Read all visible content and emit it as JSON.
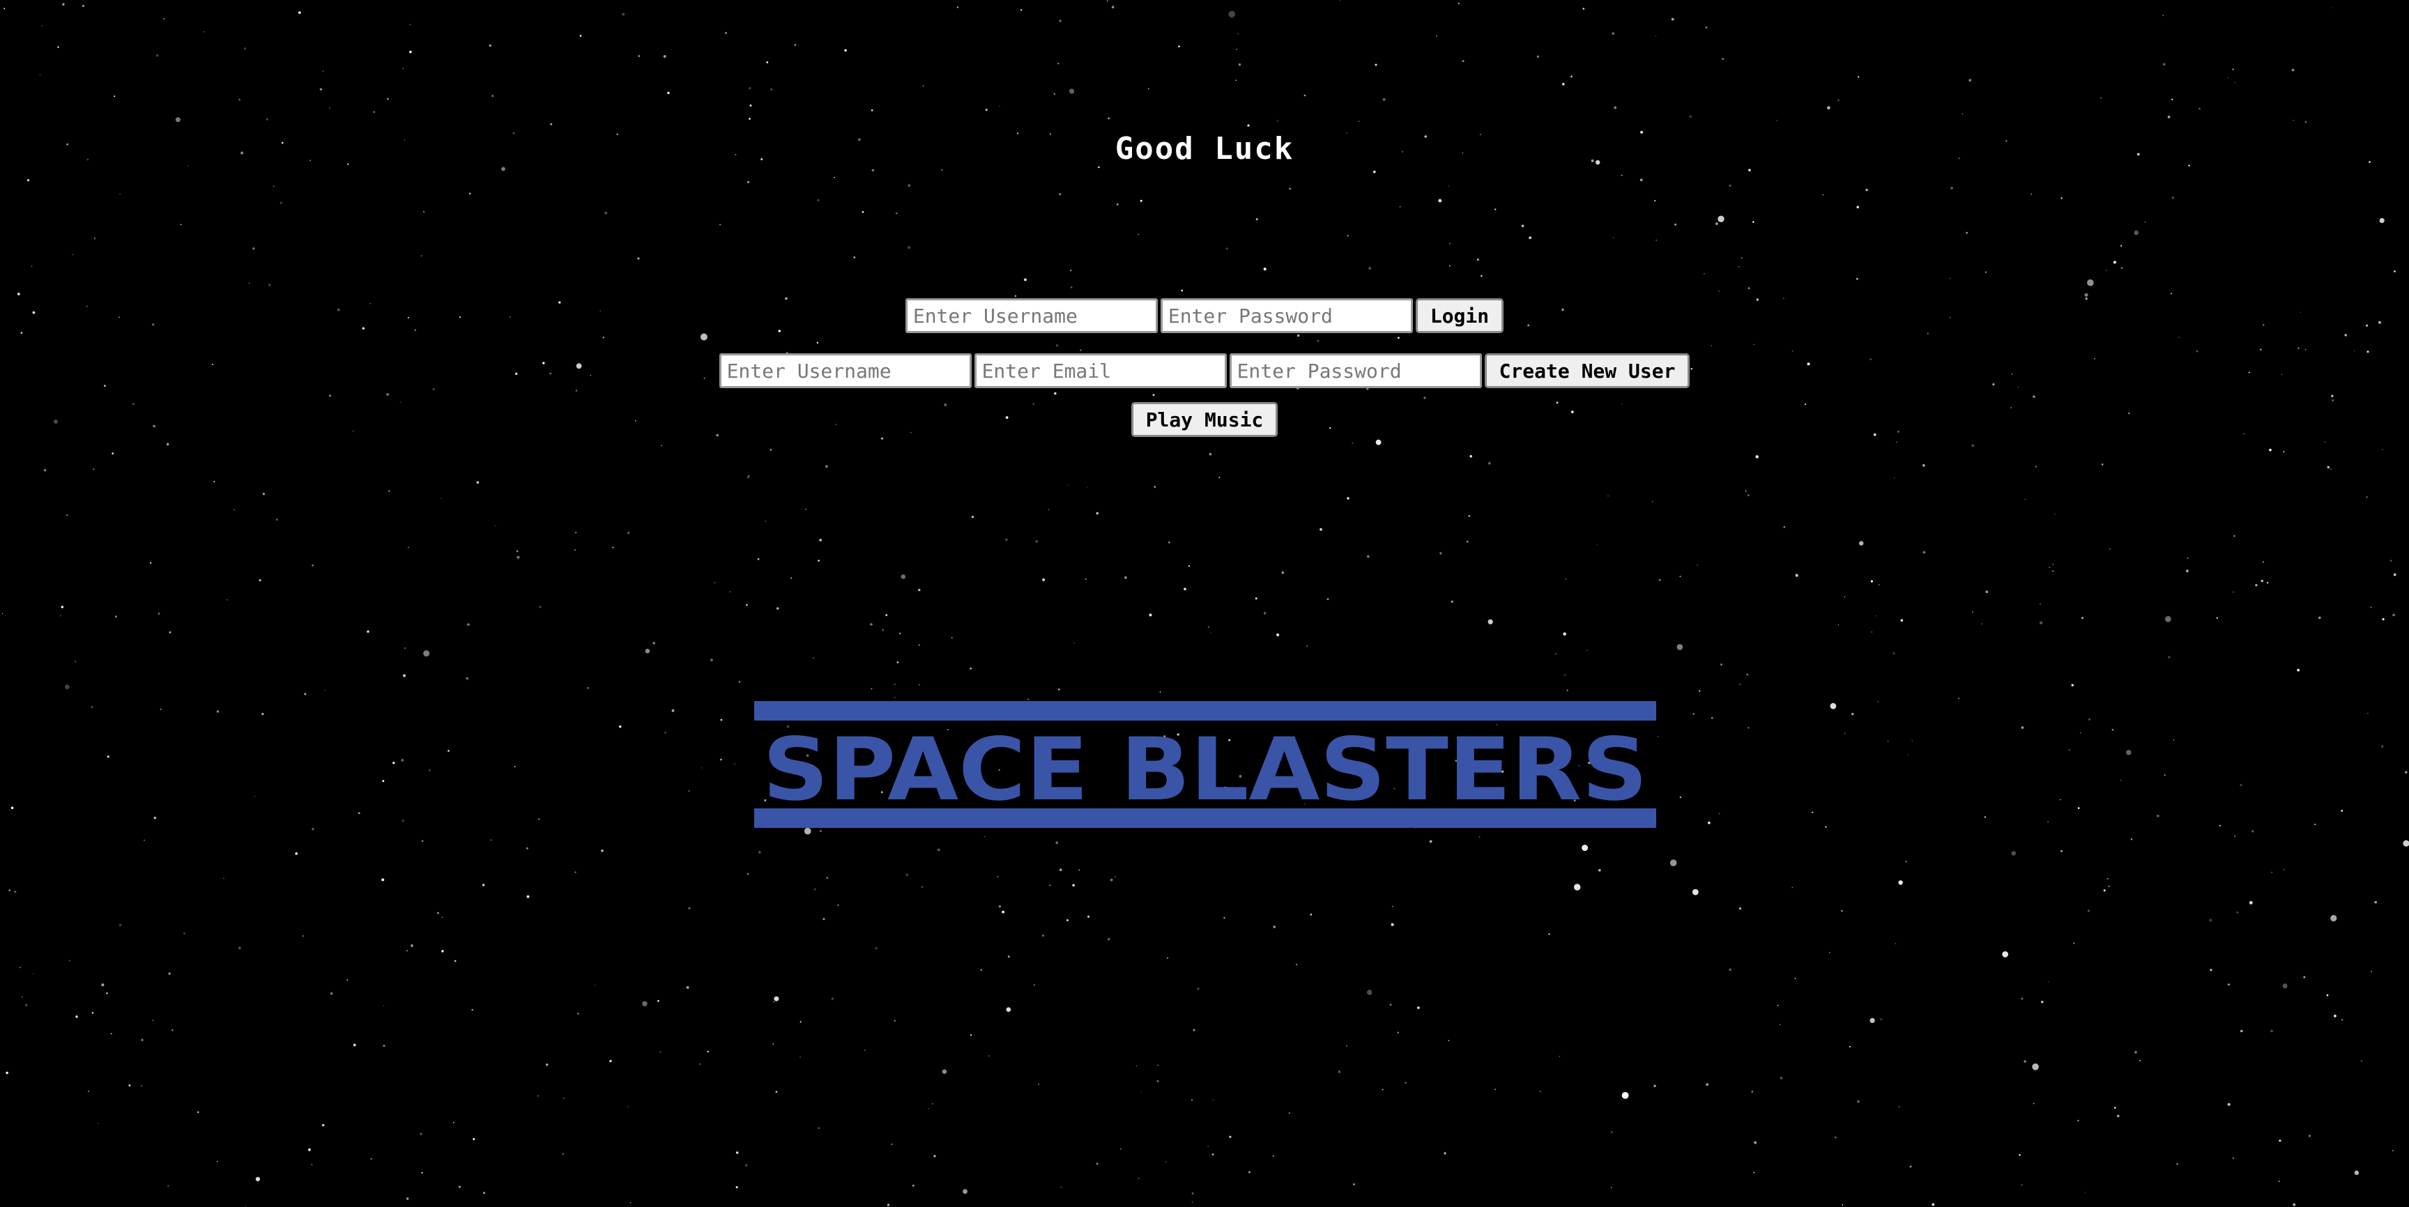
{
  "headline": "Good Luck",
  "login_form": {
    "username_placeholder": "Enter Username",
    "password_placeholder": "Enter Password",
    "login_label": "Login"
  },
  "create_form": {
    "username_placeholder": "Enter Username",
    "email_placeholder": "Enter Email",
    "password_placeholder": "Enter Password",
    "create_label": "Create New User"
  },
  "music": {
    "play_label": "Play Music"
  },
  "logo": {
    "text": "SPACE BLASTERS",
    "color": "#3a55a8"
  },
  "colors": {
    "background": "#000000",
    "stars": "#ffffff"
  }
}
